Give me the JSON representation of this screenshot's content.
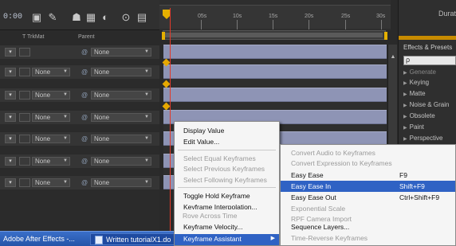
{
  "timeline": {
    "col_trkmat": "T  TrkMat",
    "col_parent": "Parent",
    "ruler_labels": [
      "05s",
      "10s",
      "15s",
      "20s",
      "25s",
      "30s"
    ],
    "toolbar_code": "0:00"
  },
  "layers": [
    {
      "trkmat": "",
      "parent": "None"
    },
    {
      "trkmat": "None",
      "parent": "None"
    },
    {
      "trkmat": "None",
      "parent": "None"
    },
    {
      "trkmat": "None",
      "parent": "None"
    },
    {
      "trkmat": "None",
      "parent": "None"
    },
    {
      "trkmat": "None",
      "parent": "None"
    },
    {
      "trkmat": "None",
      "parent": "None"
    }
  ],
  "right_panel": {
    "header": "Durat",
    "tab": "Effects & Presets",
    "search_placeholder": "ρ",
    "items": [
      "Generate",
      "Keying",
      "Matte",
      "Noise & Grain",
      "Obsolete",
      "Paint",
      "Perspective"
    ]
  },
  "context_menu": {
    "items": [
      {
        "label": "Display Value",
        "disabled": false
      },
      {
        "label": "Edit Value...",
        "disabled": false
      },
      {
        "label": "Select Equal Keyframes",
        "disabled": true
      },
      {
        "label": "Select Previous Keyframes",
        "disabled": true
      },
      {
        "label": "Select Following Keyframes",
        "disabled": true
      },
      {
        "label": "Toggle Hold Keyframe",
        "disabled": false
      },
      {
        "label": "Keyframe Interpolation...",
        "disabled": false
      },
      {
        "label": "Rove Across Time",
        "disabled": true
      },
      {
        "label": "Keyframe Velocity...",
        "disabled": false
      },
      {
        "label": "Keyframe Assistant",
        "disabled": false,
        "highlighted": true
      }
    ]
  },
  "submenu": {
    "items": [
      {
        "label": "Convert Audio to Keyframes",
        "shortcut": "",
        "disabled": true
      },
      {
        "label": "Convert Expression to Keyframes",
        "shortcut": "",
        "disabled": true
      },
      {
        "label": "Easy Ease",
        "shortcut": "F9",
        "disabled": false
      },
      {
        "label": "Easy Ease In",
        "shortcut": "Shift+F9",
        "disabled": false,
        "highlighted": true
      },
      {
        "label": "Easy Ease Out",
        "shortcut": "Ctrl+Shift+F9",
        "disabled": false
      },
      {
        "label": "Exponential Scale",
        "shortcut": "",
        "disabled": true
      },
      {
        "label": "RPF Camera Import",
        "shortcut": "",
        "disabled": true
      },
      {
        "label": "Sequence Layers...",
        "shortcut": "",
        "disabled": false
      },
      {
        "label": "Time-Reverse Keyframes",
        "shortcut": "",
        "disabled": true
      }
    ]
  },
  "taskbar": {
    "app_button": "Adobe After Effects -...",
    "doc_button": "Written tutorialX1.do"
  },
  "colors": {
    "playhead": "#e23a2a",
    "keyframe": "#e6a800",
    "layer_bar": "#8e94b5",
    "menu_highlight": "#2f62c4",
    "taskbar": "#2454a8"
  }
}
